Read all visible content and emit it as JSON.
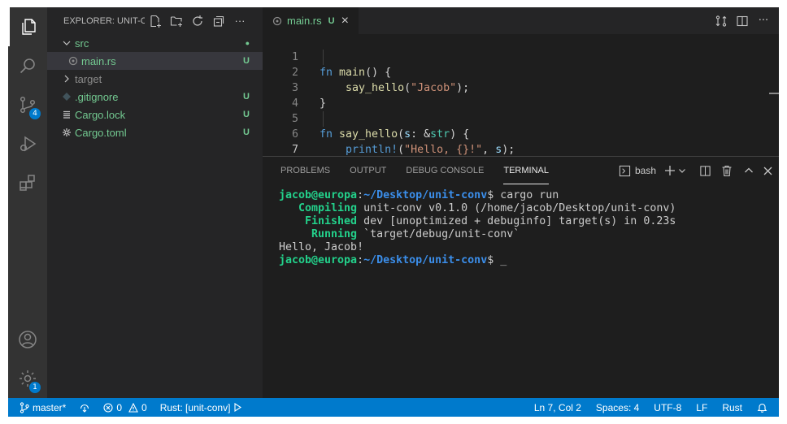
{
  "activity_bar": {
    "items": [
      "explorer-icon",
      "search-icon",
      "source-control-icon",
      "run-debug-icon",
      "extensions-icon"
    ],
    "source_control_badge": "4",
    "manage_badge": "1"
  },
  "explorer": {
    "title": "EXPLORER: UNIT-C...",
    "tree": [
      {
        "label": "src",
        "type": "folder",
        "open": true,
        "decoration": "●"
      },
      {
        "label": "main.rs",
        "type": "file",
        "decoration": "U"
      },
      {
        "label": "target",
        "type": "folder",
        "open": false,
        "decoration": ""
      },
      {
        "label": ".gitignore",
        "type": "file",
        "decoration": "U"
      },
      {
        "label": "Cargo.lock",
        "type": "file",
        "decoration": "U"
      },
      {
        "label": "Cargo.toml",
        "type": "file",
        "decoration": "U"
      }
    ]
  },
  "editor": {
    "tab": {
      "label": "main.rs",
      "decoration": "U",
      "close": "×"
    },
    "line_numbers": [
      "1",
      "2",
      "3",
      "4",
      "5",
      "6",
      "7"
    ],
    "code": {
      "l1_kw": "fn",
      "l1_fn": "main",
      "l1_rest": "() {",
      "l2_fn": "say_hello",
      "l2_open": "(",
      "l2_str": "\"Jacob\"",
      "l2_close": ");",
      "l3": "}",
      "l5_kw": "fn",
      "l5_fn": "say_hello",
      "l5_open": "(",
      "l5_param": "s",
      "l5_colon": ": &",
      "l5_type": "str",
      "l5_close": ") {",
      "l6_macro": "println!",
      "l6_open": "(",
      "l6_str": "\"Hello, {}!\"",
      "l6_comma": ", ",
      "l6_var": "s",
      "l6_close": ");",
      "l7": "}"
    }
  },
  "panel": {
    "tabs": [
      "PROBLEMS",
      "OUTPUT",
      "DEBUG CONSOLE",
      "TERMINAL"
    ],
    "active_tab": "TERMINAL",
    "shell": "bash",
    "terminal": {
      "prompt_user": "jacob@europa",
      "prompt_sep": ":",
      "prompt_path": "~/Desktop/unit-conv",
      "cmd1": "$ cargo run",
      "compiling_kw": "   Compiling",
      "compiling_text": " unit-conv v0.1.0 (/home/jacob/Desktop/unit-conv)",
      "finished_kw": "    Finished",
      "finished_text": " dev [unoptimized + debuginfo] target(s) in 0.23s",
      "running_kw": "     Running",
      "running_text": " `target/debug/unit-conv`",
      "output": "Hello, Jacob!",
      "cmd2": "$ _"
    }
  },
  "status_bar": {
    "branch": "master*",
    "errors": "0",
    "warnings": "0",
    "rust": "Rust: [unit-conv]",
    "position": "Ln 7, Col 2",
    "spaces": "Spaces: 4",
    "encoding": "UTF-8",
    "eol": "LF",
    "language": "Rust"
  },
  "colors": {
    "accent": "#007acc",
    "git_untracked": "#73c991",
    "terminal_green": "#23d18b",
    "terminal_blue": "#3b8eea"
  }
}
